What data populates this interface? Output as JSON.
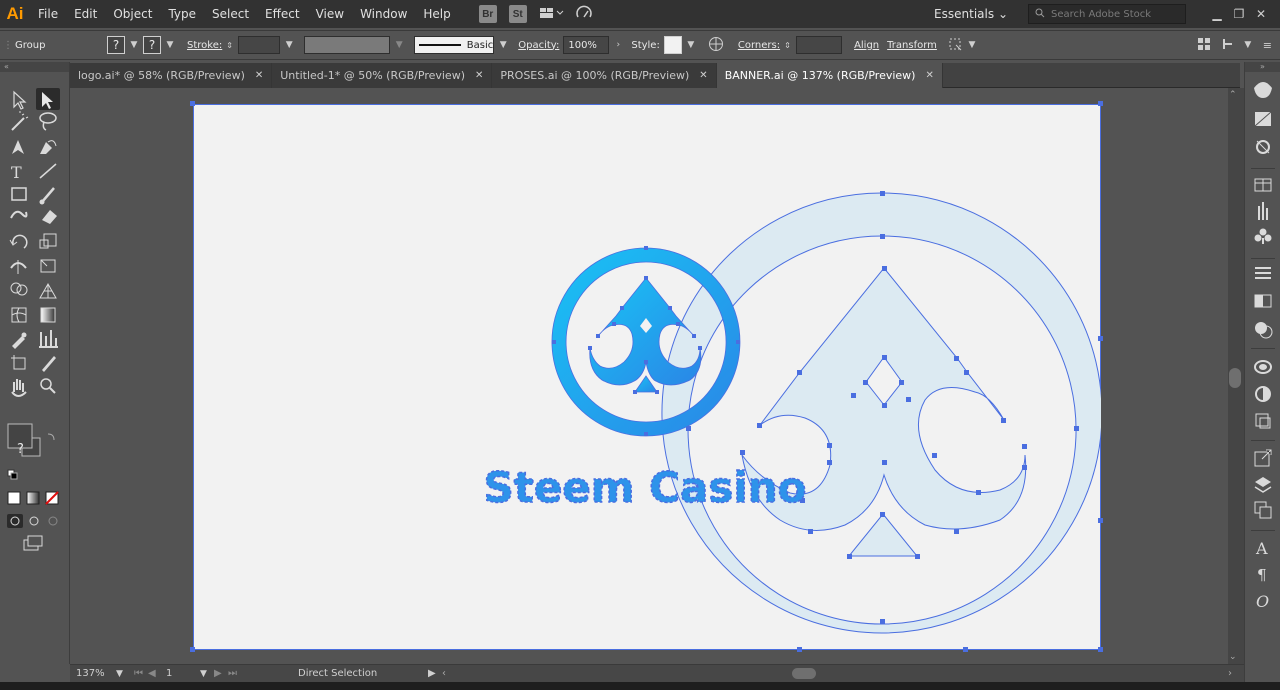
{
  "menubar": {
    "app_logo": "Ai",
    "items": [
      "File",
      "Edit",
      "Object",
      "Type",
      "Select",
      "Effect",
      "View",
      "Window",
      "Help"
    ],
    "bridge": "Br",
    "stock": "St",
    "workspace": "Essentials",
    "search_placeholder": "Search Adobe Stock"
  },
  "controlbar": {
    "selection_type": "Group",
    "fill_q": "?",
    "stroke_q": "?",
    "stroke_label": "Stroke:",
    "brush_label": "Basic",
    "opacity_label": "Opacity:",
    "opacity_value": "100%",
    "style_label": "Style:",
    "corners_label": "Corners:",
    "align_label": "Align",
    "transform_label": "Transform"
  },
  "tabs": [
    {
      "label": "logo.ai* @ 58% (RGB/Preview)",
      "active": false
    },
    {
      "label": "Untitled-1* @ 50% (RGB/Preview)",
      "active": false
    },
    {
      "label": "PROSES.ai @ 100% (RGB/Preview)",
      "active": false
    },
    {
      "label": "BANNER.ai @ 137% (RGB/Preview)",
      "active": true
    }
  ],
  "tab_close_glyph": "✕",
  "artwork": {
    "logo_text": "Steem Casino"
  },
  "toolbar": {
    "fill_swatch_q": "?"
  },
  "statusbar": {
    "zoom": "137%",
    "artboard_number": "1",
    "tool_name": "Direct Selection"
  },
  "colors": {
    "accent_blue": "#1fa8f0",
    "path_blue": "#4a6ee0",
    "ai_orange": "#ff9a00",
    "shape_fill": "#dceaf2"
  }
}
